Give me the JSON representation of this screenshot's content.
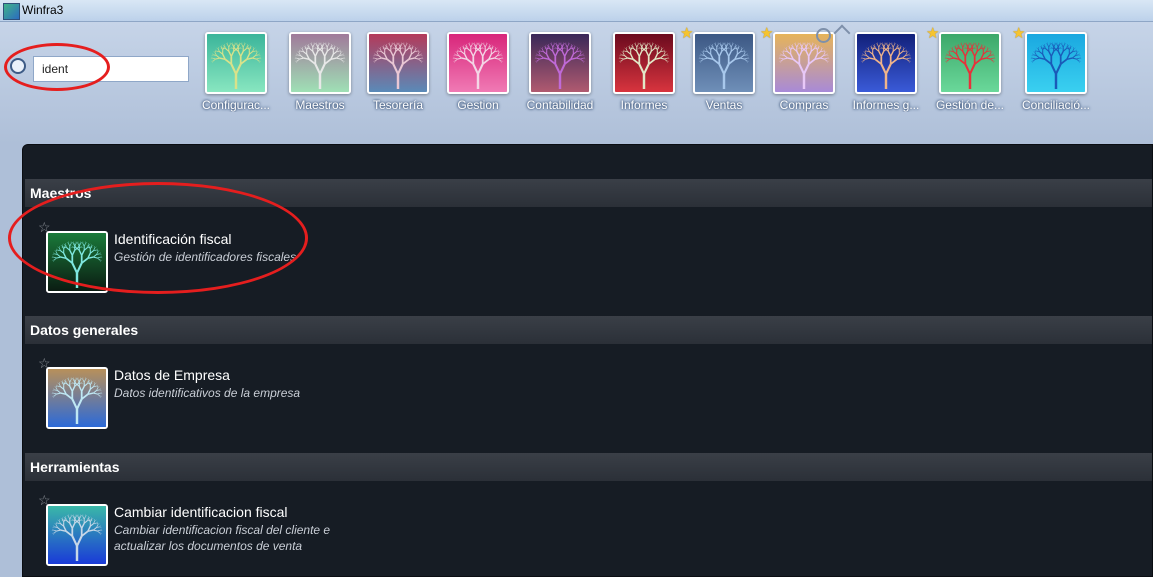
{
  "window": {
    "title": "Winfra3"
  },
  "search": {
    "value": "ident"
  },
  "modules": [
    {
      "label": "Configurac...",
      "favorite": false,
      "bg": [
        "#3bb59a",
        "#88e6c0"
      ],
      "tree": "#d9e28a"
    },
    {
      "label": "Maestros",
      "favorite": false,
      "bg": [
        "#a07a9a",
        "#9fe0b5"
      ],
      "tree": "#e8e8e8"
    },
    {
      "label": "Tesorería",
      "favorite": false,
      "bg": [
        "#b43a5a",
        "#5a8ab8"
      ],
      "tree": "#e9c7d4"
    },
    {
      "label": "Gestion",
      "favorite": false,
      "bg": [
        "#d8267a",
        "#f07ab4"
      ],
      "tree": "#f3d6e6"
    },
    {
      "label": "Contabilidad",
      "favorite": false,
      "bg": [
        "#3a2858",
        "#b05a70"
      ],
      "tree": "#c06ad8"
    },
    {
      "label": "Informes",
      "favorite": false,
      "bg": [
        "#6b0a1e",
        "#d8343e"
      ],
      "tree": "#e2e8c8"
    },
    {
      "label": "Ventas",
      "favorite": true,
      "bg": [
        "#3c5884",
        "#6f8fb8"
      ],
      "tree": "#a8c8ec"
    },
    {
      "label": "Compras",
      "favorite": true,
      "bg": [
        "#e6b45a",
        "#a88ad8"
      ],
      "tree": "#e8c8f8"
    },
    {
      "label": "Informes g...",
      "favorite": false,
      "bg": [
        "#12207a",
        "#3a5ad8"
      ],
      "tree": "#f0b48a"
    },
    {
      "label": "Gestión de...",
      "favorite": true,
      "bg": [
        "#3ca86a",
        "#6ad89a"
      ],
      "tree": "#e8303a"
    },
    {
      "label": "Conciliació...",
      "favorite": true,
      "bg": [
        "#1aa8e0",
        "#3ad0f0"
      ],
      "tree": "#1a5ab8"
    }
  ],
  "sections": [
    {
      "header": "Maestros",
      "items": [
        {
          "title": "Identificación fiscal",
          "description": "Gestión de identificadores fiscales",
          "bg": [
            "#1a7a3a",
            "#0b1c12"
          ],
          "tree": "#7fe8e0"
        }
      ]
    },
    {
      "header": "Datos generales",
      "items": [
        {
          "title": "Datos de Empresa",
          "description": "Datos identificativos de la empresa",
          "bg": [
            "#b8905a",
            "#2c6ad8"
          ],
          "tree": "#bfe8f4"
        }
      ]
    },
    {
      "header": "Herramientas",
      "items": [
        {
          "title": "Cambiar identificacion fiscal",
          "description": "Cambiar identificacion fiscal del cliente e actualizar los documentos de venta",
          "bg": [
            "#3ab8a8",
            "#1a3ad8"
          ],
          "tree": "#c8d8e8"
        }
      ]
    }
  ],
  "colors": {
    "highlight_annotation": "#e51e1e",
    "favorite_star": "#f6c430"
  }
}
